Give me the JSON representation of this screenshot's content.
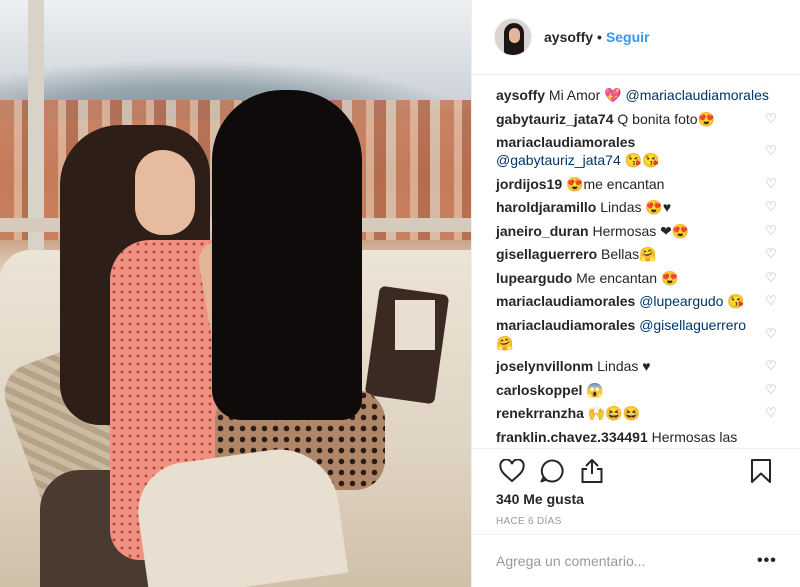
{
  "post": {
    "username": "aysoffy",
    "follow_label": "Seguir",
    "caption_text": "Mi Amor 💖",
    "caption_mention": "@mariaclaudiamorales",
    "likes": "340 Me gusta",
    "timestamp": "HACE 6 DÍAS",
    "comment_placeholder": "Agrega un comentario...",
    "more_label": "•••"
  },
  "comments": [
    {
      "user": "gabytauriz_jata74",
      "mention": "",
      "text": "Q bonita foto😍"
    },
    {
      "user": "mariaclaudiamorales",
      "mention": "@gabytauriz_jata74",
      "text": "😘😘"
    },
    {
      "user": "jordijos19",
      "mention": "",
      "text": "😍me encantan"
    },
    {
      "user": "haroldjaramillo",
      "mention": "",
      "text": "Lindas 😍♥"
    },
    {
      "user": "janeiro_duran",
      "mention": "",
      "text": "Hermosas ❤😍"
    },
    {
      "user": "gisellaguerrero",
      "mention": "",
      "text": "Bellas🤗"
    },
    {
      "user": "lupeargudo",
      "mention": "",
      "text": "Me encantan 😍"
    },
    {
      "user": "mariaclaudiamorales",
      "mention": "@lupeargudo",
      "text": "😘"
    },
    {
      "user": "mariaclaudiamorales",
      "mention": "@gisellaguerrero",
      "text": "🤗"
    },
    {
      "user": "joselynvillonm",
      "mention": "",
      "text": "Lindas ♥"
    },
    {
      "user": "carloskoppel",
      "mention": "",
      "text": "😱"
    },
    {
      "user": "renekrranzha",
      "mention": "",
      "text": "🙌😆😆"
    },
    {
      "user": "franklin.chavez.334491",
      "mention": "",
      "text": "Hermosas las"
    }
  ],
  "icons": {
    "like": "heart-outline-icon",
    "comment": "speech-bubble-icon",
    "share": "share-upload-icon",
    "save": "bookmark-icon",
    "comment_like": "small-heart-icon"
  },
  "colors": {
    "accent": "#3897f0",
    "mention": "#003569",
    "muted": "#999999",
    "text": "#262626",
    "border": "#efefef"
  }
}
